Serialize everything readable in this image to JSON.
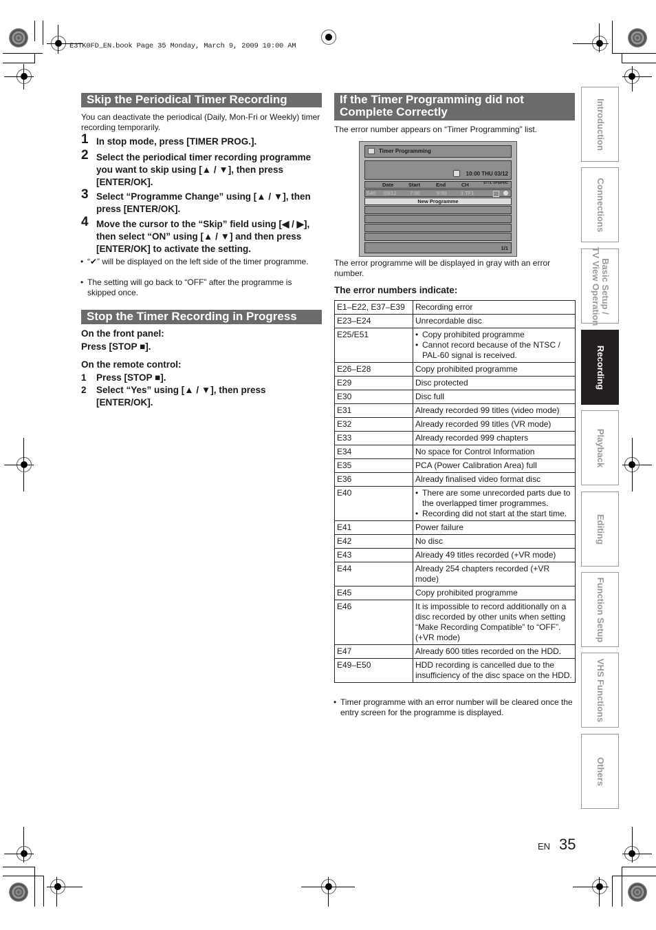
{
  "print_header": "E3TK0FD_EN.book  Page 35  Monday, March 9, 2009  10:00 AM",
  "skip_section": {
    "title": "Skip the Periodical Timer Recording",
    "intro": "You can deactivate the periodical (Daily, Mon-Fri or Weekly) timer recording temporarily.",
    "steps": [
      {
        "num": "1",
        "text": "In stop mode, press [TIMER PROG.]."
      },
      {
        "num": "2",
        "text": "Select the periodical timer recording programme you want to skip using [▲ / ▼], then press [ENTER/OK]."
      },
      {
        "num": "3",
        "text": "Select “Programme Change” using [▲ / ▼], then press [ENTER/OK]."
      },
      {
        "num": "4",
        "text": "Move the cursor to the “Skip” field using [◀ / ▶], then select “ON” using [▲ / ▼] and then press [ENTER/OK] to activate the setting."
      }
    ],
    "notes": [
      "“✔” will be displayed on the left side of the timer programme.",
      "The setting will go back to “OFF” after the programme is skipped once."
    ]
  },
  "stop_section": {
    "title": "Stop the Timer Recording in Progress",
    "front_panel_heading": "On the front panel:",
    "front_panel_step": "Press [STOP ■].",
    "remote_heading": "On the remote control:",
    "remote_steps": [
      {
        "num": "1",
        "text": "Press [STOP ■]."
      },
      {
        "num": "2",
        "text": "Select “Yes” using [▲ / ▼], then press [ENTER/OK]."
      }
    ]
  },
  "error_section": {
    "title": "If the Timer Programming did not Complete Correctly",
    "intro": "The error number appears on “Timer Programming” list.",
    "osd": {
      "title": "Timer Programming",
      "clock": "10:00 THU 03/12",
      "columns": [
        "Date",
        "Start",
        "End",
        "CH",
        "STTL VPS/PDC"
      ],
      "error_row": {
        "code": "E40",
        "date": "03/12",
        "start": "7:00",
        "end": "9:00",
        "ch": "1 TF1"
      },
      "new_programme": "New Programme",
      "page": "1/1"
    },
    "after_screen": "The error programme will be displayed in gray with an error number.",
    "table_heading": "The error numbers indicate:",
    "errors": [
      {
        "code": "E1–E22, E37–E39",
        "desc": [
          "Recording error"
        ]
      },
      {
        "code": "E23–E24",
        "desc": [
          "Unrecordable disc"
        ]
      },
      {
        "code": "E25/E51",
        "bullets": [
          "Copy prohibited programme",
          "Cannot record because of the NTSC / PAL-60 signal is received."
        ]
      },
      {
        "code": "E26–E28",
        "desc": [
          "Copy prohibited programme"
        ]
      },
      {
        "code": "E29",
        "desc": [
          "Disc protected"
        ]
      },
      {
        "code": "E30",
        "desc": [
          "Disc full"
        ]
      },
      {
        "code": "E31",
        "desc": [
          "Already recorded 99 titles (video mode)"
        ]
      },
      {
        "code": "E32",
        "desc": [
          "Already recorded 99 titles (VR mode)"
        ]
      },
      {
        "code": "E33",
        "desc": [
          "Already recorded 999 chapters"
        ]
      },
      {
        "code": "E34",
        "desc": [
          "No space for Control Information"
        ]
      },
      {
        "code": "E35",
        "desc": [
          "PCA (Power Calibration Area) full"
        ]
      },
      {
        "code": "E36",
        "desc": [
          "Already finalised video format disc"
        ]
      },
      {
        "code": "E40",
        "bullets": [
          "There are some unrecorded parts due to the overlapped timer programmes.",
          "Recording did not start at the start time."
        ]
      },
      {
        "code": "E41",
        "desc": [
          "Power failure"
        ]
      },
      {
        "code": "E42",
        "desc": [
          "No disc"
        ]
      },
      {
        "code": "E43",
        "desc": [
          "Already 49 titles recorded (+VR mode)"
        ]
      },
      {
        "code": "E44",
        "desc": [
          "Already 254 chapters recorded (+VR mode)"
        ]
      },
      {
        "code": "E45",
        "desc": [
          "Copy prohibited programme"
        ]
      },
      {
        "code": "E46",
        "desc": [
          "It is impossible to record additionally on a disc recorded by other units when setting “Make Recording Compatible” to “OFF”. (+VR mode)"
        ]
      },
      {
        "code": "E47",
        "desc": [
          "Already 600 titles recorded on the HDD."
        ]
      },
      {
        "code": "E49–E50",
        "desc": [
          "HDD recording is cancelled due to the insufficiency of the disc space on the HDD."
        ]
      }
    ],
    "footnote": "Timer programme with an error number will be cleared once the entry screen for the programme is displayed."
  },
  "side_tabs": [
    {
      "label": "Introduction",
      "active": false
    },
    {
      "label": "Connections",
      "active": false
    },
    {
      "label": "Basic Setup /\nTV View Operation",
      "active": false
    },
    {
      "label": "Recording",
      "active": true
    },
    {
      "label": "Playback",
      "active": false
    },
    {
      "label": "Editing",
      "active": false
    },
    {
      "label": "Function Setup",
      "active": false
    },
    {
      "label": "VHS Functions",
      "active": false
    },
    {
      "label": "Others",
      "active": false
    }
  ],
  "footer": {
    "lang": "EN",
    "page_number": "35"
  }
}
